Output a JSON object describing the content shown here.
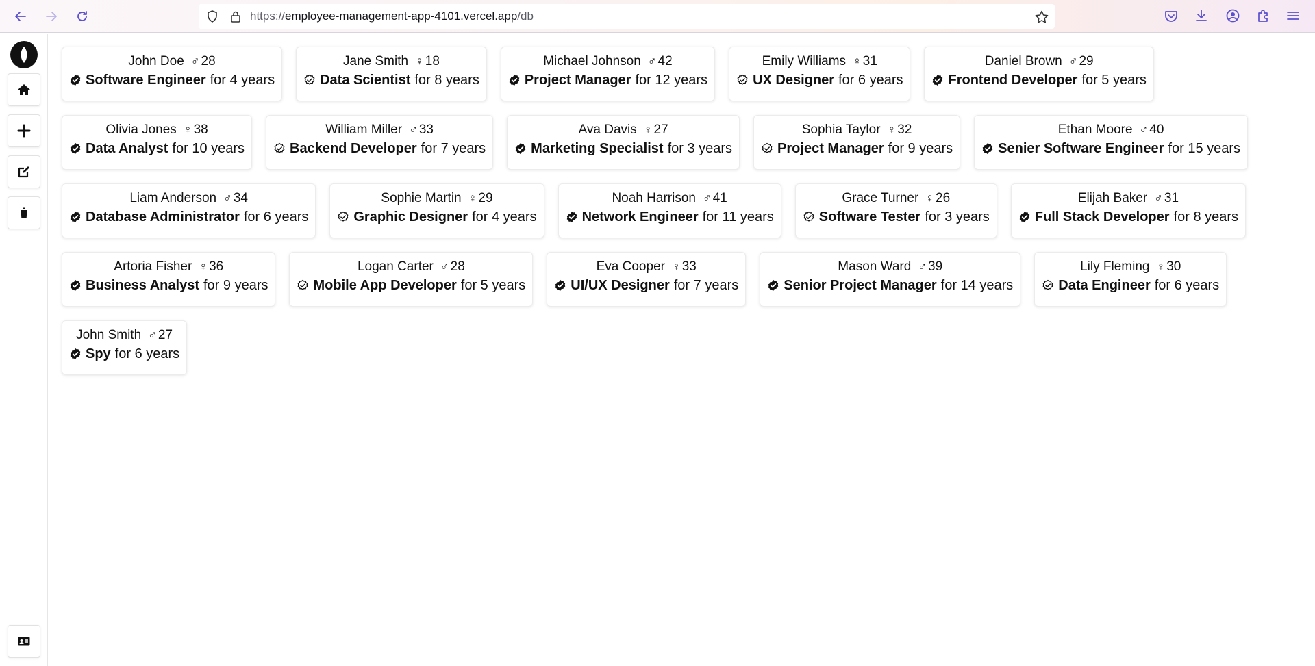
{
  "browser": {
    "url_prefix": "https://",
    "url_host": "employee-management-app-4101.vercel.app",
    "url_path": "/db"
  },
  "colors": {
    "accent": "#111111",
    "card_border": "#ececec"
  },
  "employees": [
    [
      {
        "name": "John Doe",
        "gender": "♂",
        "age": "28",
        "role": "Software Engineer",
        "duration": "for 4 years",
        "badge": "filled"
      },
      {
        "name": "Jane Smith",
        "gender": "♀",
        "age": "18",
        "role": "Data Scientist",
        "duration": "for 8 years",
        "badge": "outline"
      },
      {
        "name": "Michael Johnson",
        "gender": "♂",
        "age": "42",
        "role": "Project Manager",
        "duration": "for 12 years",
        "badge": "filled"
      },
      {
        "name": "Emily Williams",
        "gender": "♀",
        "age": "31",
        "role": "UX Designer",
        "duration": "for 6 years",
        "badge": "outline"
      },
      {
        "name": "Daniel Brown",
        "gender": "♂",
        "age": "29",
        "role": "Frontend Developer",
        "duration": "for 5 years",
        "badge": "filled"
      }
    ],
    [
      {
        "name": "Olivia Jones",
        "gender": "♀",
        "age": "38",
        "role": "Data Analyst",
        "duration": "for 10 years",
        "badge": "filled"
      },
      {
        "name": "William Miller",
        "gender": "♂",
        "age": "33",
        "role": "Backend Developer",
        "duration": "for 7 years",
        "badge": "outline"
      },
      {
        "name": "Ava Davis",
        "gender": "♀",
        "age": "27",
        "role": "Marketing Specialist",
        "duration": "for 3 years",
        "badge": "filled"
      },
      {
        "name": "Sophia Taylor",
        "gender": "♀",
        "age": "32",
        "role": "Project Manager",
        "duration": "for 9 years",
        "badge": "outline"
      },
      {
        "name": "Ethan Moore",
        "gender": "♂",
        "age": "40",
        "role": "Senier Software Engineer",
        "duration": "for 15 years",
        "badge": "filled"
      }
    ],
    [
      {
        "name": "Liam Anderson",
        "gender": "♂",
        "age": "34",
        "role": "Database Administrator",
        "duration": "for 6 years",
        "badge": "filled"
      },
      {
        "name": "Sophie Martin",
        "gender": "♀",
        "age": "29",
        "role": "Graphic Designer",
        "duration": "for 4 years",
        "badge": "outline"
      },
      {
        "name": "Noah Harrison",
        "gender": "♂",
        "age": "41",
        "role": "Network Engineer",
        "duration": "for 11 years",
        "badge": "filled"
      },
      {
        "name": "Grace Turner",
        "gender": "♀",
        "age": "26",
        "role": "Software Tester",
        "duration": "for 3 years",
        "badge": "outline"
      },
      {
        "name": "Elijah Baker",
        "gender": "♂",
        "age": "31",
        "role": "Full Stack Developer",
        "duration": "for 8 years",
        "badge": "filled"
      }
    ],
    [
      {
        "name": "Artoria Fisher",
        "gender": "♀",
        "age": "36",
        "role": "Business Analyst",
        "duration": "for 9 years",
        "badge": "filled"
      },
      {
        "name": "Logan Carter",
        "gender": "♂",
        "age": "28",
        "role": "Mobile App Developer",
        "duration": "for 5 years",
        "badge": "outline"
      },
      {
        "name": "Eva Cooper",
        "gender": "♀",
        "age": "33",
        "role": "UI/UX Designer",
        "duration": "for 7 years",
        "badge": "filled"
      },
      {
        "name": "Mason Ward",
        "gender": "♂",
        "age": "39",
        "role": "Senior Project Manager",
        "duration": "for 14 years",
        "badge": "filled"
      },
      {
        "name": "Lily Fleming",
        "gender": "♀",
        "age": "30",
        "role": "Data Engineer",
        "duration": "for 6 years",
        "badge": "outline"
      }
    ],
    [
      {
        "name": "John Smith",
        "gender": "♂",
        "age": "27",
        "role": "Spy",
        "duration": "for 6 years",
        "badge": "filled"
      }
    ]
  ],
  "sidebar": {
    "items": [
      {
        "icon": "home-icon"
      },
      {
        "icon": "plus-icon"
      },
      {
        "icon": "edit-icon"
      },
      {
        "icon": "trash-icon"
      }
    ],
    "footer_icon": "id-card-icon"
  }
}
